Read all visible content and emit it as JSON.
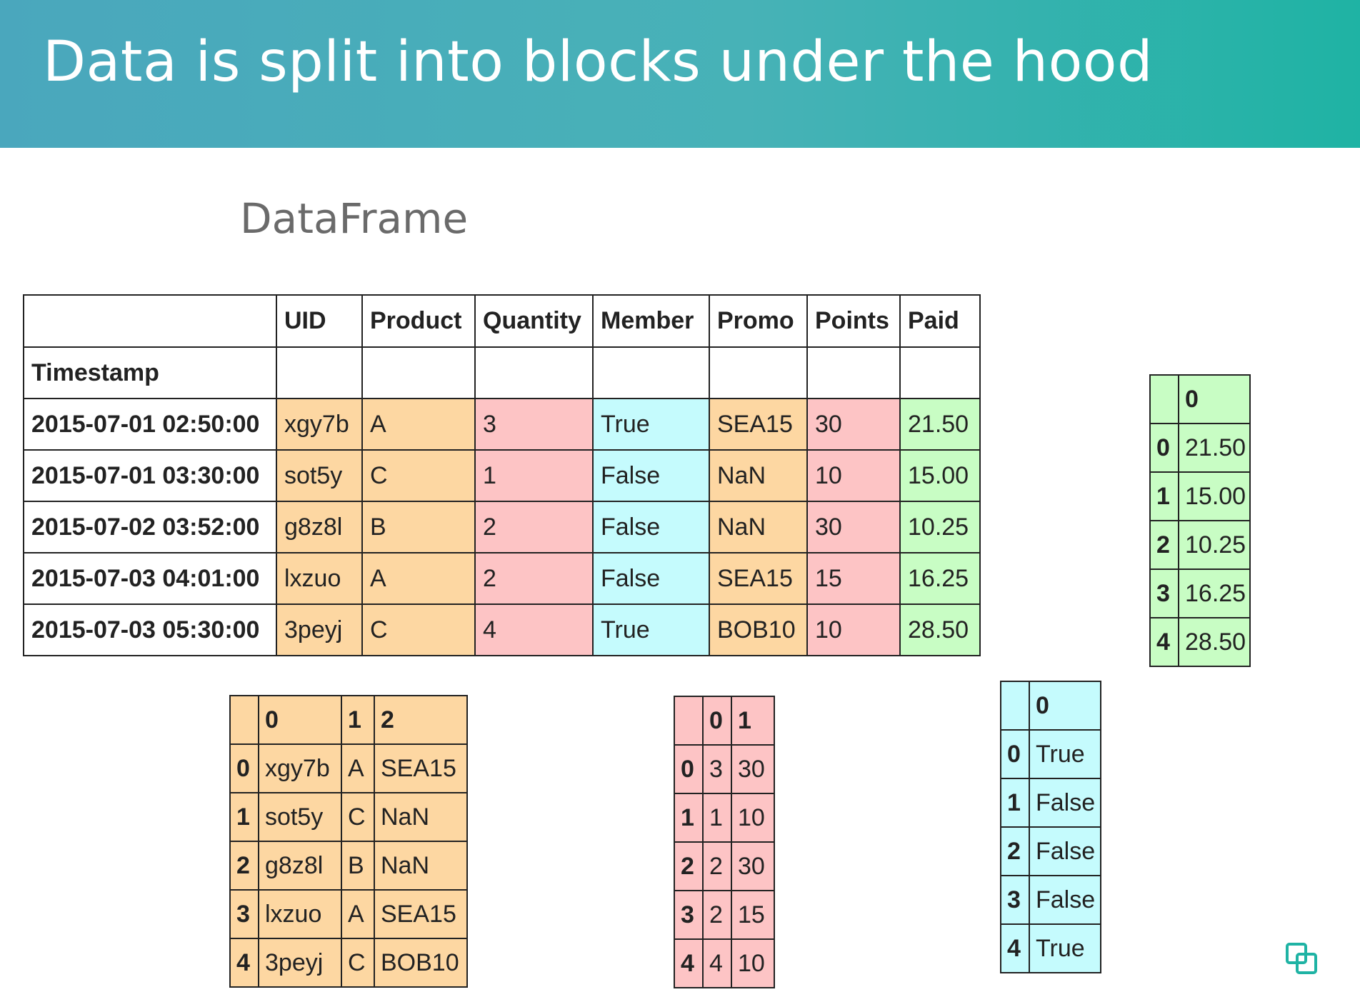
{
  "slide": {
    "title": "Data is split into blocks under the hood",
    "subtitle": "DataFrame"
  },
  "dataframe": {
    "columns": [
      "UID",
      "Product",
      "Quantity",
      "Member",
      "Promo",
      "Points",
      "Paid"
    ],
    "index_name": "Timestamp",
    "rows": [
      {
        "ts": "2015-07-01 02:50:00",
        "cells": [
          "xgy7b",
          "A",
          "3",
          "True",
          "SEA15",
          "30",
          "21.50"
        ]
      },
      {
        "ts": "2015-07-01 03:30:00",
        "cells": [
          "sot5y",
          "C",
          "1",
          "False",
          "NaN",
          "10",
          "15.00"
        ]
      },
      {
        "ts": "2015-07-02 03:52:00",
        "cells": [
          "g8z8l",
          "B",
          "2",
          "False",
          "NaN",
          "30",
          "10.25"
        ]
      },
      {
        "ts": "2015-07-03 04:01:00",
        "cells": [
          "lxzuo",
          "A",
          "2",
          "False",
          "SEA15",
          "15",
          "16.25"
        ]
      },
      {
        "ts": "2015-07-03 05:30:00",
        "cells": [
          "3peyj",
          "C",
          "4",
          "True",
          "BOB10",
          "10",
          "28.50"
        ]
      }
    ]
  },
  "object_block": {
    "headers": [
      "0",
      "1",
      "2"
    ],
    "rows": [
      {
        "idx": "0",
        "cells": [
          "xgy7b",
          "A",
          "SEA15"
        ]
      },
      {
        "idx": "1",
        "cells": [
          "sot5y",
          "C",
          "NaN"
        ]
      },
      {
        "idx": "2",
        "cells": [
          "g8z8l",
          "B",
          "NaN"
        ]
      },
      {
        "idx": "3",
        "cells": [
          "lxzuo",
          "A",
          "SEA15"
        ]
      },
      {
        "idx": "4",
        "cells": [
          "3peyj",
          "C",
          "BOB10"
        ]
      }
    ]
  },
  "int_block": {
    "headers": [
      "0",
      "1"
    ],
    "rows": [
      {
        "idx": "0",
        "cells": [
          "3",
          "30"
        ]
      },
      {
        "idx": "1",
        "cells": [
          "1",
          "10"
        ]
      },
      {
        "idx": "2",
        "cells": [
          "2",
          "30"
        ]
      },
      {
        "idx": "3",
        "cells": [
          "2",
          "15"
        ]
      },
      {
        "idx": "4",
        "cells": [
          "4",
          "10"
        ]
      }
    ]
  },
  "bool_block": {
    "headers": [
      "0"
    ],
    "rows": [
      {
        "idx": "0",
        "cells": [
          "True"
        ]
      },
      {
        "idx": "1",
        "cells": [
          "False"
        ]
      },
      {
        "idx": "2",
        "cells": [
          "False"
        ]
      },
      {
        "idx": "3",
        "cells": [
          "False"
        ]
      },
      {
        "idx": "4",
        "cells": [
          "True"
        ]
      }
    ]
  },
  "float_block": {
    "headers": [
      "0"
    ],
    "rows": [
      {
        "idx": "0",
        "cells": [
          "21.50"
        ]
      },
      {
        "idx": "1",
        "cells": [
          "15.00"
        ]
      },
      {
        "idx": "2",
        "cells": [
          "10.25"
        ]
      },
      {
        "idx": "3",
        "cells": [
          "16.25"
        ]
      },
      {
        "idx": "4",
        "cells": [
          "28.50"
        ]
      }
    ]
  },
  "colors": {
    "object_block": "#fdd7a2",
    "int_block": "#fdc4c5",
    "bool_block": "#c5fbfd",
    "float_block": "#c8fdc4",
    "header_gradient_start": "#4aa7bd",
    "header_gradient_end": "#1fb3a4"
  },
  "icons": {
    "corner": "overlapping-squares-icon"
  }
}
